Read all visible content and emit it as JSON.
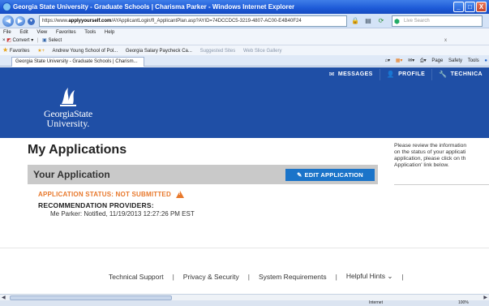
{
  "window": {
    "title": "Georgia State University - Graduate Schools | Charisma Parker - Windows Internet Explorer",
    "buttons": {
      "minimize": "_",
      "maximize": "□",
      "close": "X"
    }
  },
  "address_bar": {
    "url_prefix": "https://www.",
    "url_domain": "applyyourself.com",
    "url_rest": "/AYApplicantLogin/fl_ApplicantPlan.asp?AYID=74DCCDC5-3219-4807-AC00-E4B40F24",
    "search_placeholder": "Live Search"
  },
  "menu": {
    "items": [
      "File",
      "Edit",
      "View",
      "Favorites",
      "Tools",
      "Help"
    ]
  },
  "convert_bar": {
    "convert_label": "Convert",
    "select_label": "Select",
    "close_label": "x"
  },
  "favorites_bar": {
    "favorites_label": "Favorites",
    "items": [
      "Andrew Young School of Pol...",
      "Georgia Salary Paycheck Ca...",
      "Suggested Sites",
      "Web Slice Gallery"
    ]
  },
  "tab": {
    "title": "Georgia State University - Graduate Schools | Charism...",
    "tools": [
      "Page",
      "Safety",
      "Tools"
    ]
  },
  "site": {
    "nav": [
      {
        "icon": "envelope-icon",
        "label": "MESSAGES"
      },
      {
        "icon": "person-icon",
        "label": "PROFILE"
      },
      {
        "icon": "wrench-icon",
        "label": "TECHNICA"
      }
    ],
    "logo": {
      "line1": "GeorgiaState",
      "line2": "University."
    },
    "colors": {
      "header": "#1f4fa6",
      "button": "#1b74c9",
      "status": "#e8782b",
      "bar": "#c9c9c9"
    }
  },
  "main": {
    "page_title": "My Applications",
    "application_bar_title": "Your Application",
    "edit_button_label": "EDIT APPLICATION",
    "status_text": "APPLICATION STATUS: NOT SUBMITTED",
    "recommendation_label": "RECOMMENDATION PROVIDERS:",
    "recommendation_item": "Me Parker: Notified, 11/19/2013 12:27:26 PM EST"
  },
  "sidebar": {
    "lines": [
      "Please review the information",
      "on the status of your applicati",
      "application, please click on th",
      "Application' link below."
    ]
  },
  "footer": {
    "links": [
      "Technical Support",
      "Privacy & Security",
      "System Requirements",
      "Helpful Hints"
    ],
    "separator": "|",
    "hints_arrow": "⌄"
  },
  "status_bar": {
    "zone": "Internet",
    "zoom": "100%"
  }
}
